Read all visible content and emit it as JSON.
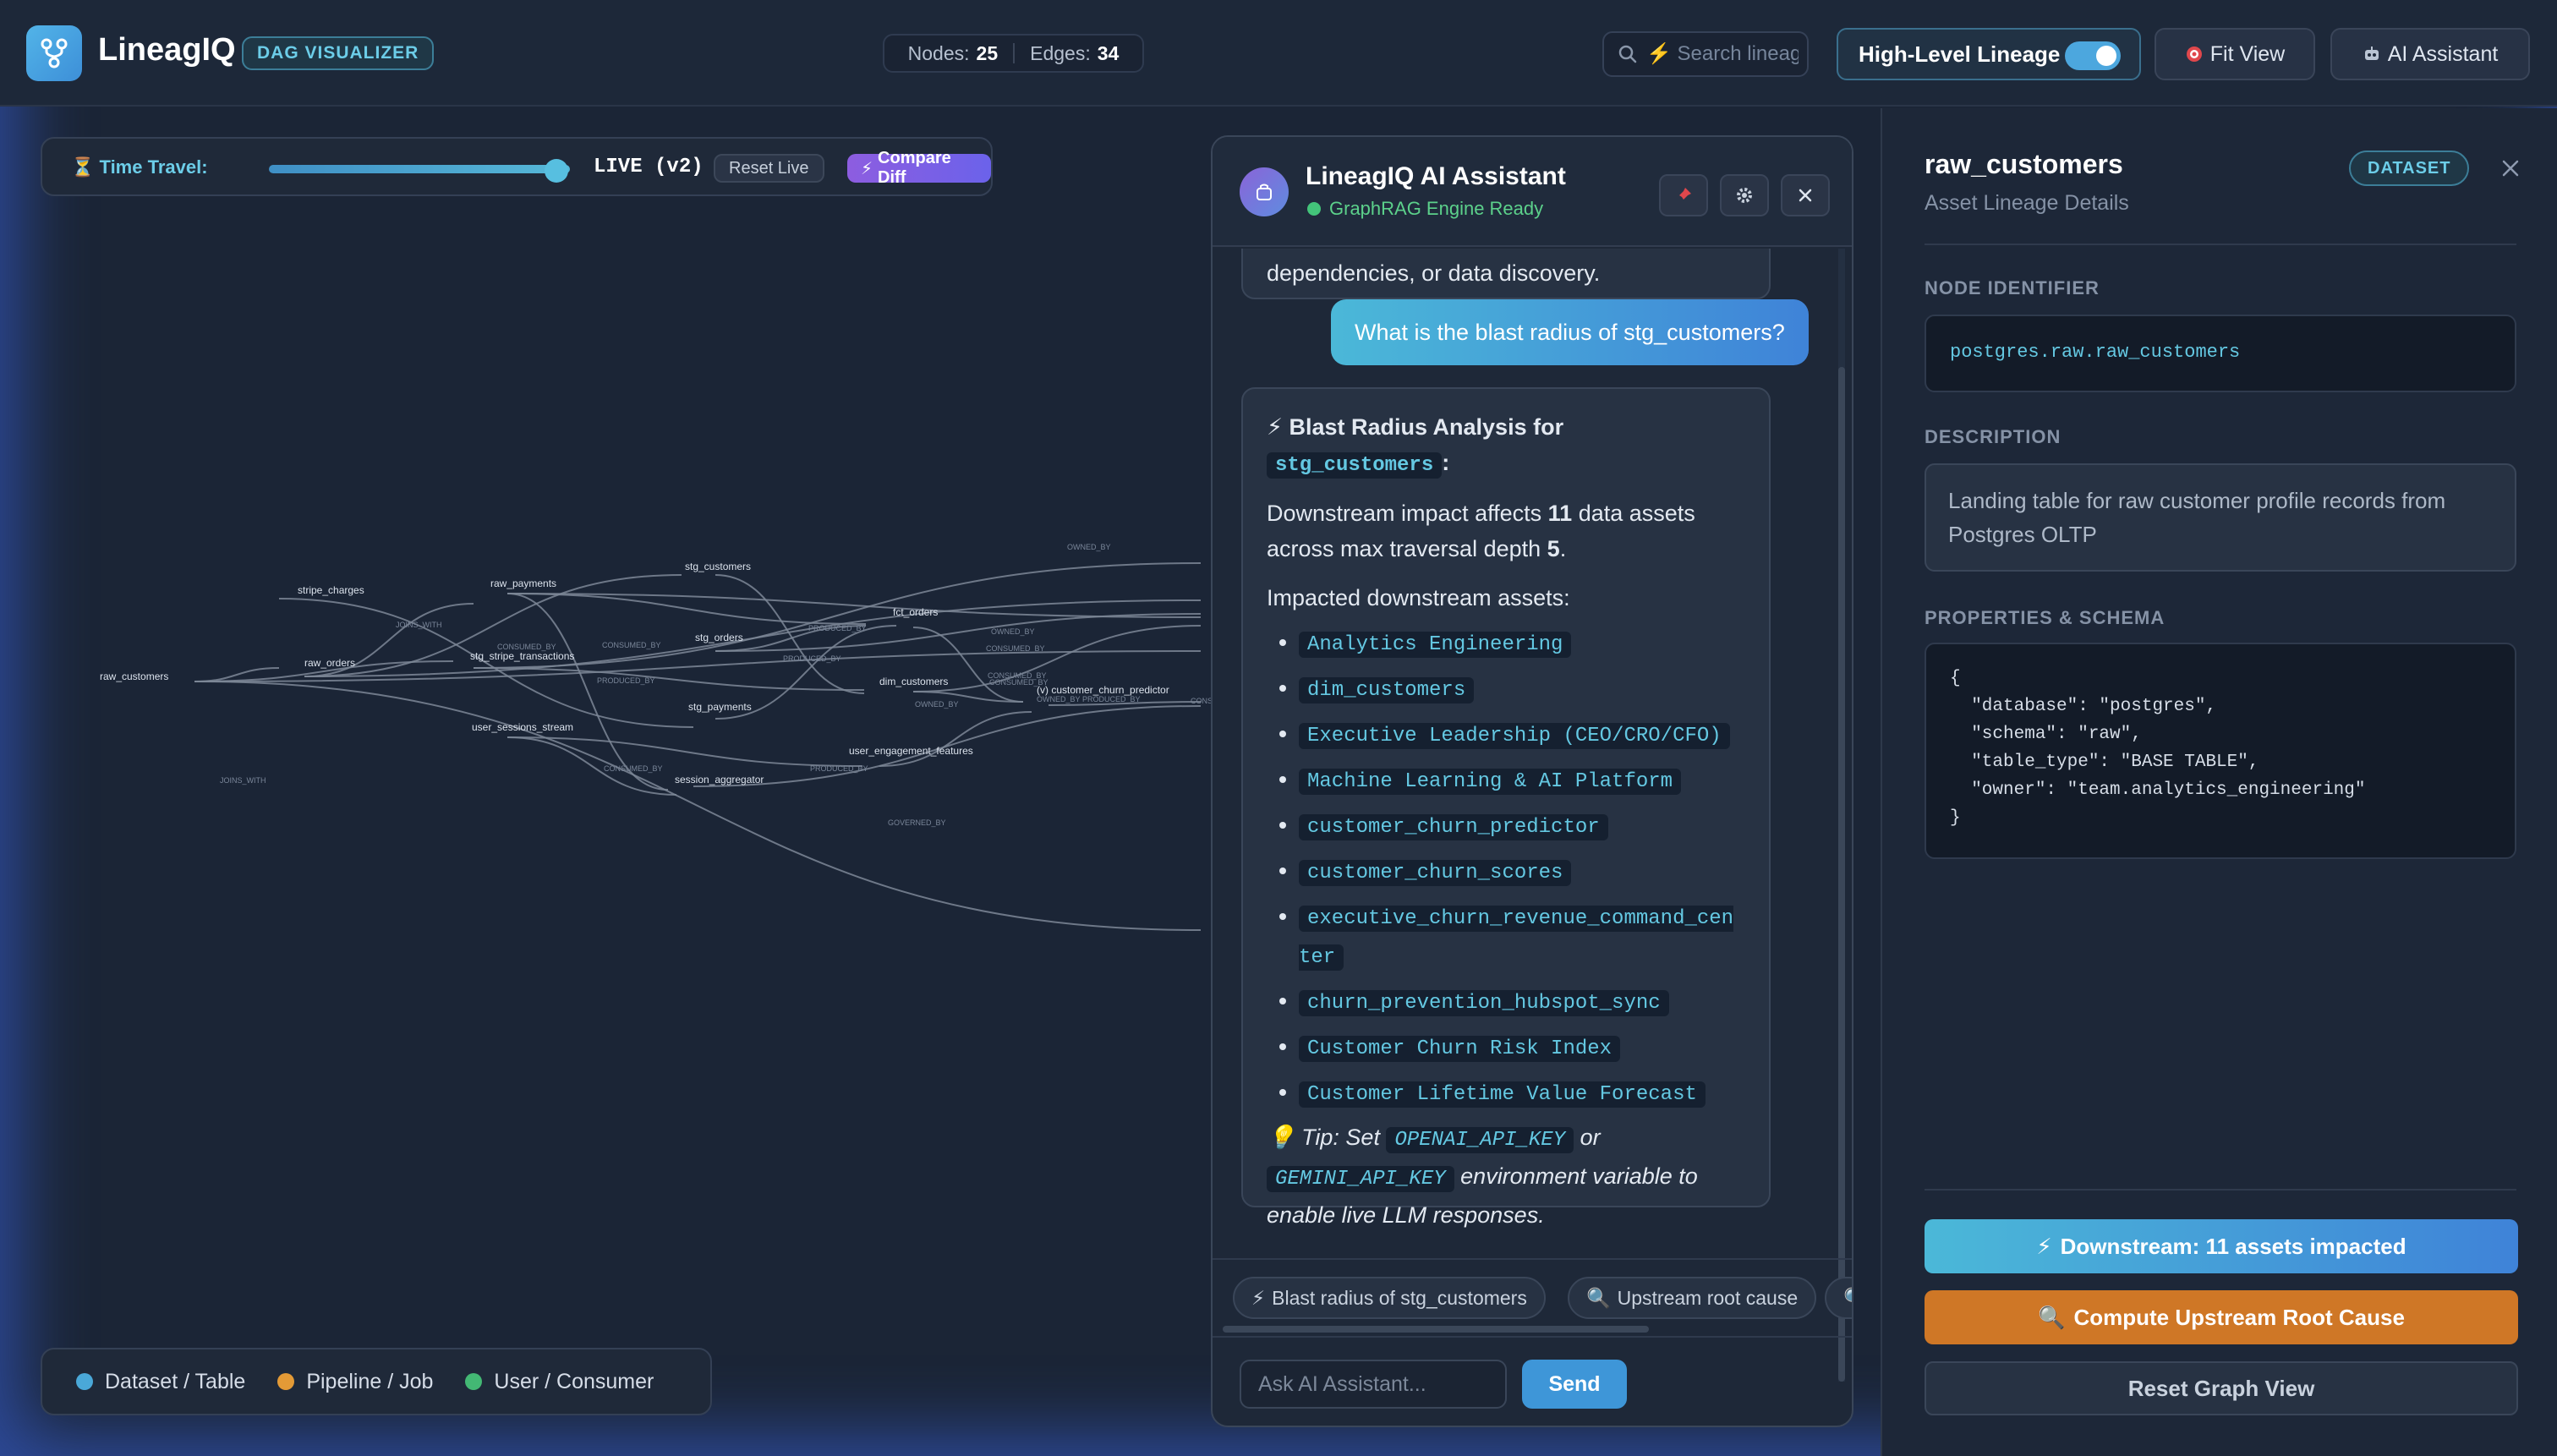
{
  "header": {
    "brand": "LineagIQ",
    "badge": "DAG VISUALIZER",
    "stats": {
      "nodes_label": "Nodes:",
      "nodes_value": "25",
      "edges_label": "Edges:",
      "edges_value": "34"
    },
    "search_placeholder": "⚡ Search lineage...",
    "toggle_label": "High-Level Lineage",
    "toggle_on": true,
    "fit_view": "Fit View",
    "ai_assistant": "AI Assistant"
  },
  "time_travel": {
    "label": "Time Travel:",
    "slider_value": 1.0,
    "live_label": "LIVE (v2)",
    "reset_label": "Reset Live",
    "compare_label": "Compare Diff"
  },
  "graph": {
    "nodes": [
      "stripe_charges",
      "raw_payments",
      "stg_customers",
      "raw_customers",
      "raw_orders",
      "stg_stripe_transactions",
      "stg_orders",
      "fct_orders",
      "dim_customers",
      "stg_payments",
      "(v) customer_churn_predictor",
      "user_sessions_stream",
      "session_aggregator",
      "user_engagement_features"
    ],
    "edge_labels": [
      "JOINS_WITH",
      "JOINS_WITH",
      "CONSUMED_BY",
      "CONSUMED_BY",
      "PRODUCED_BY",
      "PRODUCED_BY",
      "PRODUCED_BY",
      "OWNED_BY",
      "OWNED_BY",
      "OWNED_BY",
      "CONSUMED_BY",
      "CONSUMED_BY",
      "CONSUMED_BY",
      "PRODUCED_BY",
      "CONSUMED_BY",
      "GOVERNED_BY",
      "OWNED_BY",
      "PRODUCED_BY",
      "CONSUMED_BY"
    ]
  },
  "legend": [
    {
      "label": "Dataset / Table",
      "color": "#4aa8d8"
    },
    {
      "label": "Pipeline / Job",
      "color": "#e39a36"
    },
    {
      "label": "User / Consumer",
      "color": "#43b874"
    }
  ],
  "assistant": {
    "title": "LineagIQ AI Assistant",
    "status": "GraphRAG Engine Ready",
    "prev_message_tail": "dependencies, or data discovery.",
    "user_message": "What is the blast radius of stg_customers?",
    "response": {
      "heading": "Blast Radius Analysis for",
      "heading_asset": "stg_customers",
      "heading_suffix": ":",
      "impact_pre": "Downstream impact affects",
      "impact_count": "11",
      "impact_mid": "data assets across max traversal depth",
      "impact_depth": "5",
      "impact_post": ".",
      "list_heading": "Impacted downstream assets:",
      "assets": [
        "Analytics Engineering",
        "dim_customers",
        "Executive Leadership (CEO/CRO/CFO)",
        "Machine Learning & AI Platform",
        "customer_churn_predictor",
        "customer_churn_scores",
        "executive_churn_revenue_command_center",
        "churn_prevention_hubspot_sync",
        "Customer Churn Risk Index",
        "Customer Lifetime Value Forecast"
      ],
      "tip_pre": "Tip: Set",
      "tip_key1": "OPENAI_API_KEY",
      "tip_or": "or",
      "tip_key2": "GEMINI_API_KEY",
      "tip_post": "environment variable to enable live LLM responses."
    },
    "chips": [
      "Blast radius of stg_customers",
      "Upstream root cause"
    ],
    "input_placeholder": "Ask AI Assistant...",
    "send_label": "Send"
  },
  "details": {
    "title": "raw_customers",
    "subtitle": "Asset Lineage Details",
    "badge": "DATASET",
    "node_identifier_label": "NODE IDENTIFIER",
    "node_identifier": "postgres.raw.raw_customers",
    "description_label": "DESCRIPTION",
    "description": "Landing table for raw customer profile records from Postgres OLTP",
    "properties_label": "PROPERTIES & SCHEMA",
    "properties_json": "{\n  \"database\": \"postgres\",\n  \"schema\": \"raw\",\n  \"table_type\": \"BASE TABLE\",\n  \"owner\": \"team.analytics_engineering\"\n}",
    "downstream_btn": "Downstream: 11 assets impacted",
    "upstream_btn": "Compute Upstream Root Cause",
    "reset_btn": "Reset Graph View"
  }
}
